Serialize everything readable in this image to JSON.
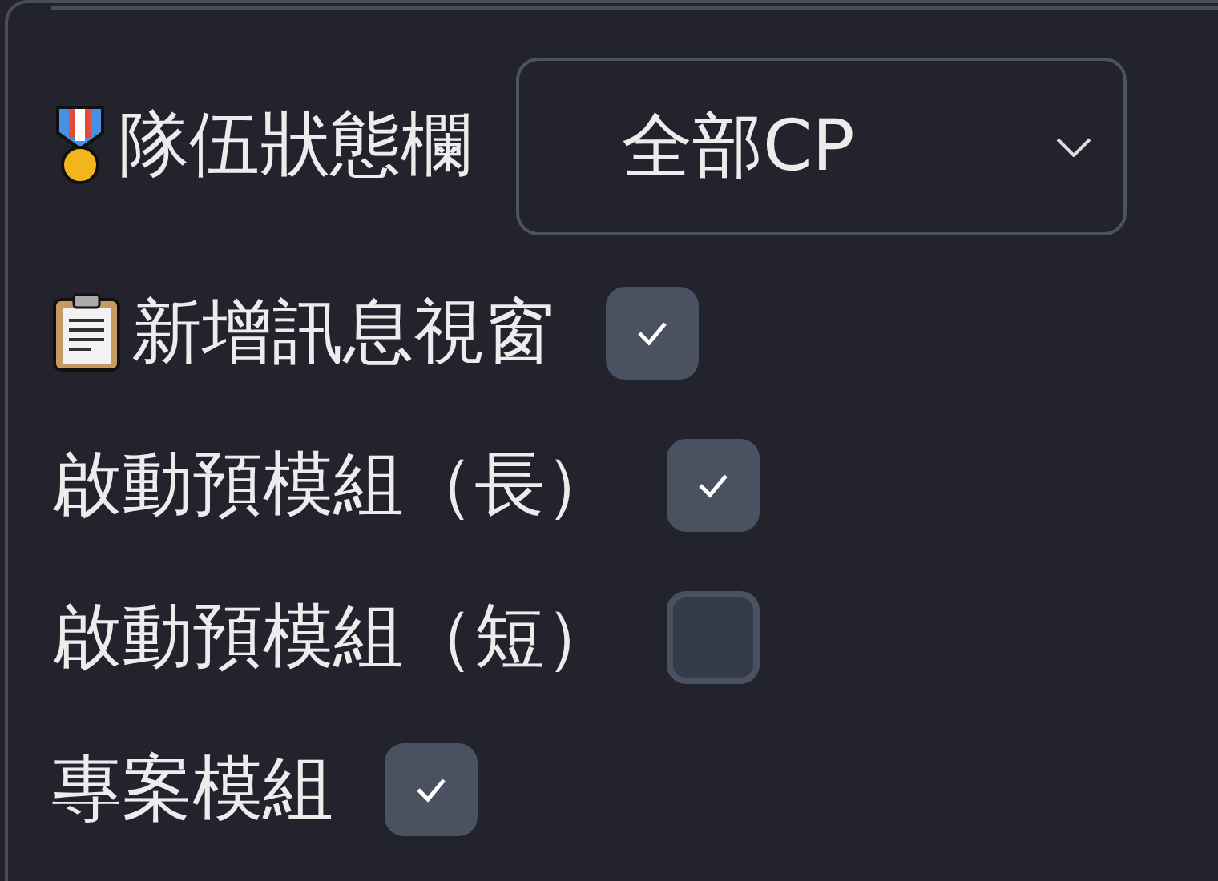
{
  "settings": [
    {
      "kind": "select",
      "label": "隊伍狀態欄",
      "value": "全部CP"
    },
    {
      "kind": "checkbox",
      "label": "新增訊息視窗",
      "checked": true
    },
    {
      "kind": "checkbox",
      "label": "啟動預模組（長）",
      "checked": true
    },
    {
      "kind": "checkbox",
      "label": "啟動預模組（短）",
      "checked": false
    },
    {
      "kind": "checkbox",
      "label": "專案模組",
      "checked": true
    }
  ]
}
